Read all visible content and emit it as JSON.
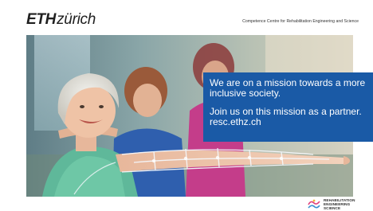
{
  "header": {
    "logo_bold": "ETH",
    "logo_rest": "zürich",
    "centre_name": "Competence Centre for Rehabilitation Engineering and Science"
  },
  "mission": {
    "line1": "We are on a mission towards a more inclusive society.",
    "line2": "Join us on this mission as a partner.",
    "url": "resc.ethz.ch"
  },
  "footer_logo": {
    "words": [
      "REHABILITATION",
      "ENGINEERING",
      "SCIENCE"
    ]
  },
  "colors": {
    "accent_blue": "#1a5aa6",
    "logo_text": "#1f1f1f"
  }
}
